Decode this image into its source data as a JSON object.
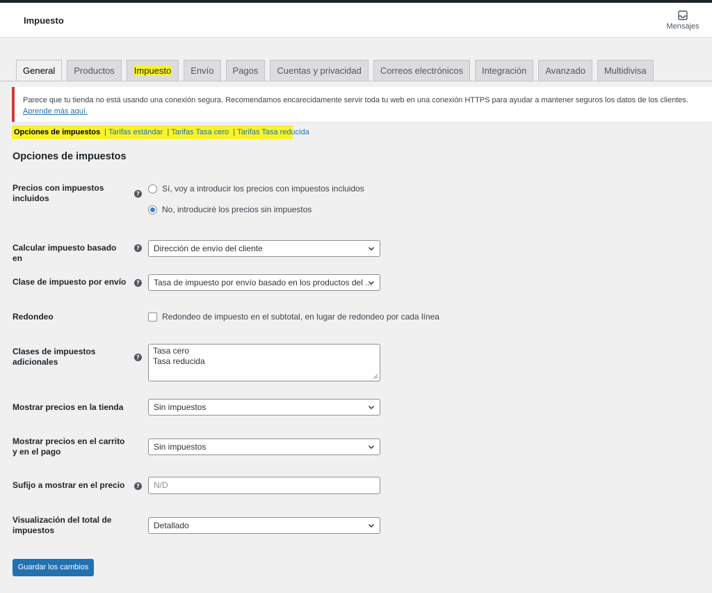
{
  "header": {
    "title": "Impuesto",
    "messages_label": "Mensajes",
    "messages_icon": "inbox-icon"
  },
  "tabs": [
    {
      "label": "General",
      "active": true
    },
    {
      "label": "Productos"
    },
    {
      "label": "Impuesto",
      "highlighted": true
    },
    {
      "label": "Envío"
    },
    {
      "label": "Pagos"
    },
    {
      "label": "Cuentas y privacidad"
    },
    {
      "label": "Correos electrónicos"
    },
    {
      "label": "Integración"
    },
    {
      "label": "Avanzado"
    },
    {
      "label": "Multidivisa"
    }
  ],
  "notice": {
    "text": "Parece que tu tienda no está usando una conexión segura. Recomendamos encarecidamente servir toda tu web en una conexión HTTPS para ayudar a mantener seguros los datos de los clientes. ",
    "link": "Aprende más aquí."
  },
  "subnav": {
    "current": "Opciones de impuestos",
    "separator": "|",
    "links": [
      "Tarifas estándar",
      "Tarifas Tasa cero",
      "Tarifas Tasa reducida"
    ]
  },
  "section_title": "Opciones de impuestos",
  "fields": {
    "prices_incl": {
      "label": "Precios con impuestos incluidos",
      "option_yes": "Sí, voy a introducir los precios con impuestos incluidos",
      "option_no": "No, introduciré los precios sin impuestos",
      "selected": "no"
    },
    "calc_based_on": {
      "label": "Calcular impuesto basado en",
      "value": "Dirección de envío del cliente"
    },
    "shipping_tax_class": {
      "label": "Clase de impuesto por envío",
      "value": "Tasa de impuesto por envío basado en los productos del ..."
    },
    "rounding": {
      "label": "Redondeo",
      "checkbox_label": "Redondeo de impuesto en el subtotal, en lugar de redondeo por cada línea",
      "checked": false
    },
    "additional_classes": {
      "label": "Clases de impuestos adicionales",
      "lines": [
        "Tasa cero",
        "Tasa reducida"
      ]
    },
    "display_shop": {
      "label": "Mostrar precios en la tienda",
      "value": "Sin impuestos"
    },
    "display_cart": {
      "label": "Mostrar precios en el carrito y en el pago",
      "value": "Sin impuestos"
    },
    "price_suffix": {
      "label": "Sufijo a mostrar en el precio",
      "placeholder": "N/D"
    },
    "tax_total_display": {
      "label": "Visualización del total de impuestos",
      "value": "Detallado"
    }
  },
  "help_icon_glyph": "?",
  "save_label": "Guardar los cambios",
  "colors": {
    "accent": "#2271b1",
    "highlight": "#f9f32b",
    "notice_border": "#d63638"
  }
}
